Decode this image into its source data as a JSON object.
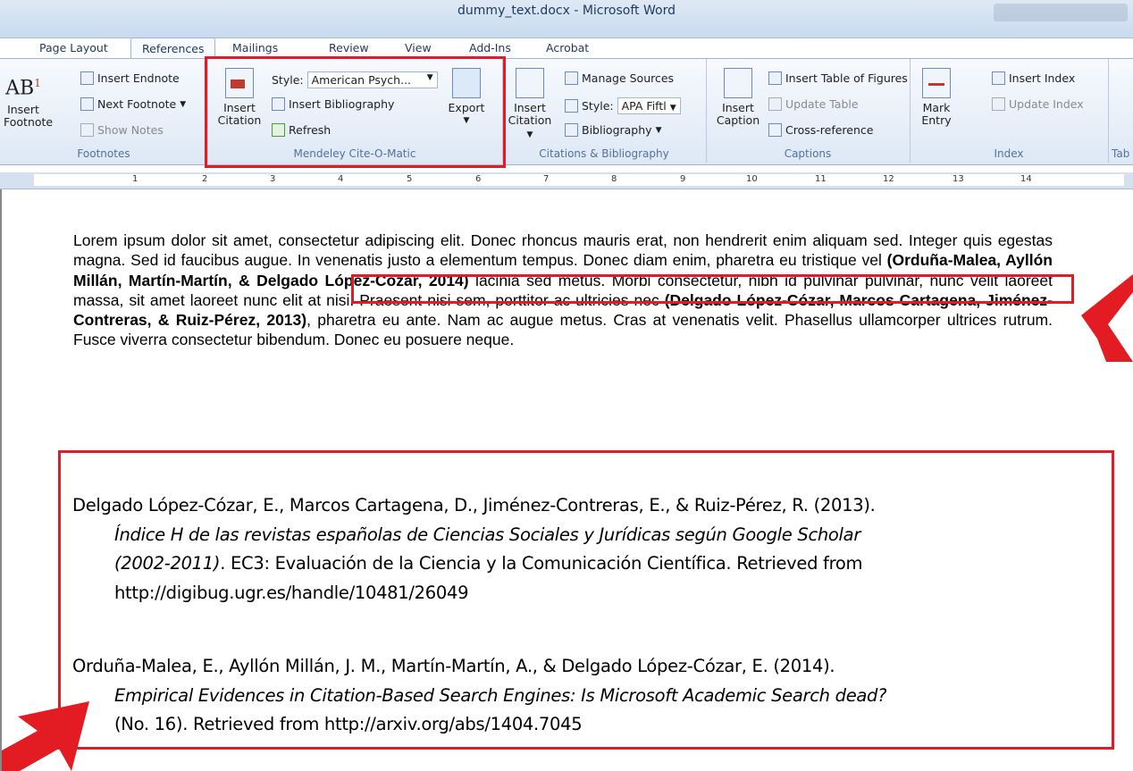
{
  "window": {
    "title": "dummy_text.docx - Microsoft Word"
  },
  "tabs": [
    "Page Layout",
    "References",
    "Mailings",
    "Review",
    "View",
    "Add-Ins",
    "Acrobat"
  ],
  "ribbon": {
    "footnotes": {
      "label": "Footnotes",
      "insert_footnote_line1": "Insert",
      "insert_footnote_line2": "Footnote",
      "insert_endnote": "Insert Endnote",
      "next_footnote": "Next Footnote",
      "show_notes": "Show Notes",
      "ab_glyph": "AB"
    },
    "mendeley": {
      "label": "Mendeley Cite-O-Matic",
      "insert_citation_line1": "Insert",
      "insert_citation_line2": "Citation",
      "style_label": "Style:",
      "style_value": "American Psych...",
      "insert_bibliography": "Insert Bibliography",
      "refresh": "Refresh",
      "export": "Export"
    },
    "citations": {
      "label": "Citations & Bibliography",
      "insert_citation_line1": "Insert",
      "insert_citation_line2": "Citation",
      "manage_sources": "Manage Sources",
      "style_label": "Style:",
      "style_value": "APA Fiftl",
      "bibliography": "Bibliography"
    },
    "captions": {
      "label": "Captions",
      "insert_caption_line1": "Insert",
      "insert_caption_line2": "Caption",
      "insert_table_of_figures": "Insert Table of Figures",
      "update_table": "Update Table",
      "cross_reference": "Cross-reference"
    },
    "index": {
      "label": "Index",
      "mark_entry_line1": "Mark",
      "mark_entry_line2": "Entry",
      "insert_index": "Insert Index",
      "update_index": "Update Index"
    },
    "table_partial": "Tab"
  },
  "ruler": {
    "numbers": [
      "1",
      "2",
      "3",
      "4",
      "5",
      "6",
      "7",
      "8",
      "9",
      "10",
      "11",
      "12",
      "13",
      "14"
    ]
  },
  "document": {
    "paragraph": {
      "t1": "Lorem ipsum dolor sit amet, consectetur adipiscing elit. Donec rhoncus mauris erat, non hendrerit enim aliquam sed. Integer quis egestas magna. Sed id faucibus augue. In venenatis justo a elementum tempus. Donec diam enim, pharetra eu tristique vel ",
      "cite1": "(Orduña-Malea, Ayllón Millán, Martín-Martín, & Delgado López-Cózar, 2014)",
      "t2": " lacinia sed metus. Morbi consectetur, nibh id pulvinar pulvinar, nunc velit laoreet massa, sit amet laoreet nunc elit at nisi. Praesent nisi sem, porttitor ac ultricies nec ",
      "cite2": "(Delgado López-Cózar, Marcos Cartagena, Jiménez-Contreras, & Ruiz-Pérez, 2013)",
      "t3": ", pharetra eu ante. Nam ac augue metus. Cras at venenatis velit. Phasellus ullamcorper ultrices rutrum. Fusce viverra consectetur bibendum. Donec eu posuere neque."
    },
    "references": [
      {
        "authors": "Delgado López-Cózar, E., Marcos Cartagena, D., Jiménez-Contreras, E., & Ruiz-Pérez, R. (2013).",
        "title_a": "Índice H de las revistas españolas de Ciencias Sociales y Jurídicas según Google Scholar",
        "title_b": "(2002-2011)",
        "rest": ". EC3: Evaluación de la Ciencia y la Comunicación Científica. Retrieved from",
        "url": "http://digibug.ugr.es/handle/10481/26049"
      },
      {
        "authors": "Orduña-Malea, E., Ayllón Millán, J. M., Martín-Martín, A., & Delgado López-Cózar, E. (2014).",
        "title": "Empirical Evidences in Citation-Based Search Engines: Is Microsoft Academic Search dead?",
        "rest": "(No. 16). Retrieved from http://arxiv.org/abs/1404.7045"
      }
    ]
  },
  "colors": {
    "highlight_red": "#e31b23",
    "ribbon_blue": "#dde8f5"
  }
}
